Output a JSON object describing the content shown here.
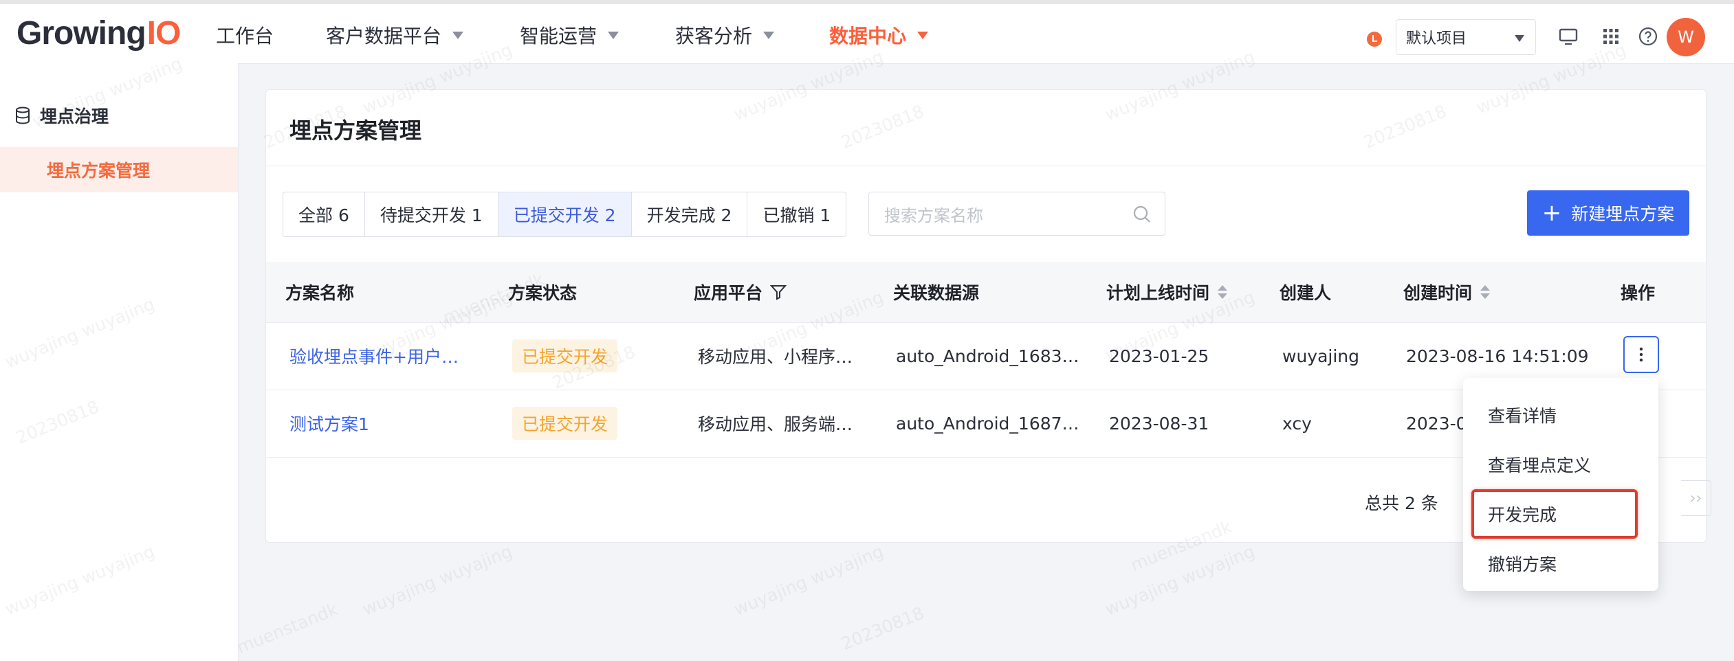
{
  "brand": {
    "logo_main": "Growing",
    "logo_accent": "IO"
  },
  "nav": {
    "items": [
      {
        "label": "工作台"
      },
      {
        "label": "客户数据平台"
      },
      {
        "label": "智能运营"
      },
      {
        "label": "获客分析"
      },
      {
        "label": "数据中心"
      }
    ],
    "project_select": "默认项目",
    "avatar_letter": "W"
  },
  "sidebar": {
    "group_label": "埋点治理",
    "item_label": "埋点方案管理"
  },
  "page": {
    "title": "埋点方案管理",
    "tabs": [
      {
        "label": "全部 6"
      },
      {
        "label": "待提交开发 1"
      },
      {
        "label": "已提交开发 2"
      },
      {
        "label": "开发完成 2"
      },
      {
        "label": "已撤销 1"
      }
    ],
    "search_placeholder": "搜索方案名称",
    "new_button": "新建埋点方案"
  },
  "table": {
    "columns": [
      "方案名称",
      "方案状态",
      "应用平台",
      "关联数据源",
      "计划上线时间",
      "创建人",
      "创建时间",
      "操作"
    ],
    "rows": [
      {
        "name": "验收埋点事件+用户…",
        "status": "已提交开发",
        "platform": "移动应用、小程序…",
        "source": "auto_Android_1683…",
        "plan_date": "2023-01-25",
        "creator": "wuyajing",
        "created": "2023-08-16 14:51:09"
      },
      {
        "name": "测试方案1",
        "status": "已提交开发",
        "platform": "移动应用、服务端…",
        "source": "auto_Android_1687…",
        "plan_date": "2023-08-31",
        "creator": "xcy",
        "created": "2023-0"
      }
    ],
    "total": "总共 2 条"
  },
  "action_menu": {
    "items": [
      {
        "label": "查看详情"
      },
      {
        "label": "查看埋点定义"
      },
      {
        "label": "开发完成"
      },
      {
        "label": "撤销方案"
      }
    ]
  },
  "watermark": {
    "user": "wuyajing wuyajing",
    "date": "20230818",
    "org": "muenstandk"
  },
  "colors": {
    "accent": "#fc5f3a",
    "primary": "#3867f0",
    "status": "#f4a52e",
    "highlight": "#e03b2f"
  }
}
